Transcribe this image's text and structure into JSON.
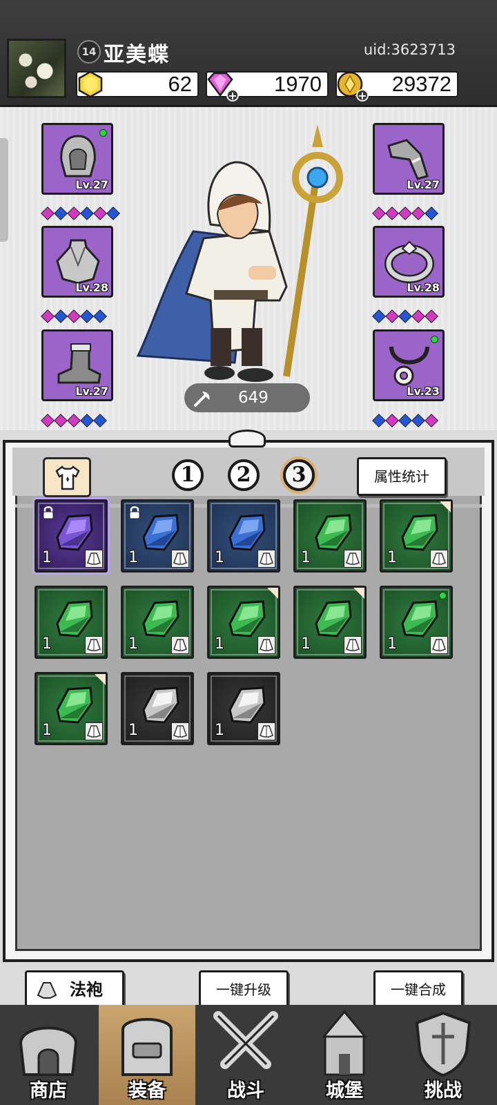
{
  "player": {
    "level": "14",
    "name": "亚美蝶",
    "uid": "uid:3623713"
  },
  "currencies": [
    {
      "name": "gold-gem",
      "value": "62",
      "color": "#f2d43a"
    },
    {
      "name": "diamond",
      "value": "1970",
      "color": "#e25fd6"
    },
    {
      "name": "coin",
      "value": "29372",
      "color": "#e6b52a"
    }
  ],
  "equipment": {
    "left": [
      {
        "slot": "hood",
        "level": "Lv.27",
        "gems": [
          "p",
          "b",
          "p",
          "b",
          "p",
          "b"
        ]
      },
      {
        "slot": "cape",
        "level": "Lv.28",
        "gems": [
          "p",
          "b",
          "p",
          "b",
          "b"
        ]
      },
      {
        "slot": "boots",
        "level": "Lv.27",
        "gems": [
          "p",
          "p",
          "p",
          "b",
          "b"
        ]
      }
    ],
    "right": [
      {
        "slot": "sleeve",
        "level": "Lv.27",
        "gems": [
          "p",
          "p",
          "p",
          "p",
          "b"
        ]
      },
      {
        "slot": "ring",
        "level": "Lv.28",
        "gems": [
          "b",
          "p",
          "b",
          "p",
          "p"
        ]
      },
      {
        "slot": "necklace",
        "level": "Lv.23",
        "gems": [
          "b",
          "p",
          "b",
          "b",
          "p"
        ]
      }
    ]
  },
  "hero": {
    "power": "649"
  },
  "panel": {
    "tabs": [
      "1",
      "2",
      "3"
    ],
    "active_tab": "3",
    "stats_button": "属性统计"
  },
  "inventory": [
    {
      "rarity": "purple",
      "count": "1",
      "locked": true
    },
    {
      "rarity": "blue",
      "count": "1",
      "locked": true
    },
    {
      "rarity": "blue",
      "count": "1"
    },
    {
      "rarity": "green",
      "count": "1"
    },
    {
      "rarity": "green",
      "count": "1",
      "corner": true
    },
    {
      "rarity": "green",
      "count": "1"
    },
    {
      "rarity": "green",
      "count": "1"
    },
    {
      "rarity": "green",
      "count": "1",
      "corner": true
    },
    {
      "rarity": "green",
      "count": "1",
      "corner": true
    },
    {
      "rarity": "green",
      "count": "1",
      "dot": true
    },
    {
      "rarity": "green",
      "count": "1",
      "corner": true
    },
    {
      "rarity": "black",
      "count": "1"
    },
    {
      "rarity": "black",
      "count": "1"
    }
  ],
  "actions": {
    "filter_label": "法袍",
    "upgrade_all": "一键升级",
    "merge_all": "一键合成"
  },
  "nav": [
    {
      "label": "商店",
      "icon": "shop-icon"
    },
    {
      "label": "装备",
      "icon": "equipment-bag-icon",
      "active": true
    },
    {
      "label": "战斗",
      "icon": "crossed-swords-icon"
    },
    {
      "label": "城堡",
      "icon": "castle-icon"
    },
    {
      "label": "挑战",
      "icon": "challenge-shield-icon"
    }
  ]
}
